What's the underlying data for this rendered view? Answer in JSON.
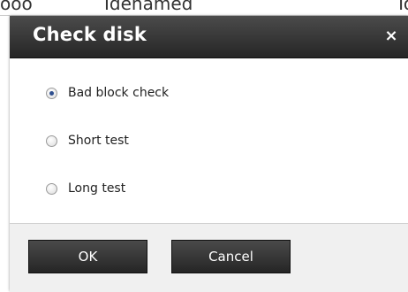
{
  "background": {
    "text_1": "ooo",
    "text_2": "Idenamed",
    "text_3": "To"
  },
  "dialog": {
    "title": "Check disk",
    "close_label": "×",
    "options": [
      {
        "label": "Bad block check",
        "selected": true
      },
      {
        "label": "Short test",
        "selected": false
      },
      {
        "label": "Long test",
        "selected": false
      }
    ],
    "ok_label": "OK",
    "cancel_label": "Cancel"
  },
  "colors": {
    "titlebar": "#333333",
    "button": "#333333",
    "footer": "#f0f0f0",
    "radio_selected": "#2f4f8f"
  }
}
